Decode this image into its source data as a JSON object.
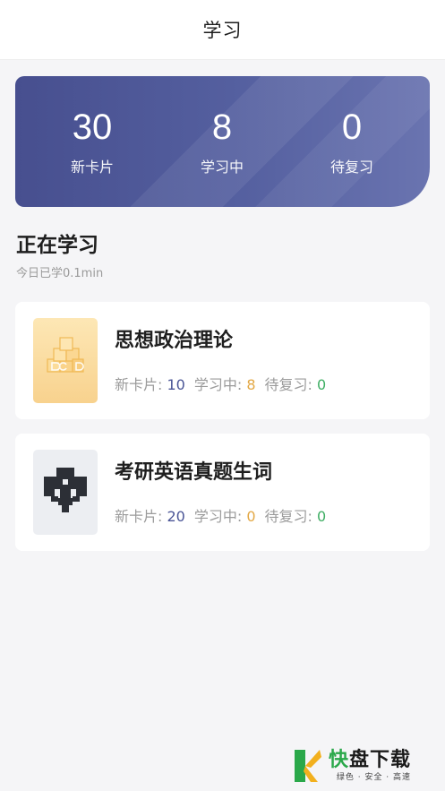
{
  "navbar": {
    "title": "学习"
  },
  "stats": {
    "new_cards": {
      "value": "30",
      "label": "新卡片"
    },
    "learning": {
      "value": "8",
      "label": "学习中"
    },
    "review": {
      "value": "0",
      "label": "待复习"
    }
  },
  "section": {
    "title": "正在学习",
    "subtitle": "今日已学0.1min"
  },
  "decks": [
    {
      "name": "思想政治理论",
      "new_label": "新卡片: ",
      "new_value": "10",
      "learning_label": "学习中: ",
      "learning_value": "8",
      "review_label": "待复习: ",
      "review_value": "0",
      "cover_icon": "cube-stack-icon"
    },
    {
      "name": "考研英语真题生词",
      "new_label": "新卡片: ",
      "new_value": "20",
      "learning_label": "学习中: ",
      "learning_value": "0",
      "review_label": "待复习: ",
      "review_value": "0",
      "cover_icon": "pixel-figure-icon"
    }
  ],
  "watermark": {
    "brand_first": "快",
    "brand_rest": "盘下载",
    "tagline": "绿色 · 安全 · 高速",
    "icon": "k-logo-icon"
  },
  "colors": {
    "card_gradient_start": "#474f8f",
    "card_gradient_end": "#6a74b0",
    "new_value": "#4a5596",
    "learning_value": "#e3a845",
    "review_value": "#3fae64"
  }
}
